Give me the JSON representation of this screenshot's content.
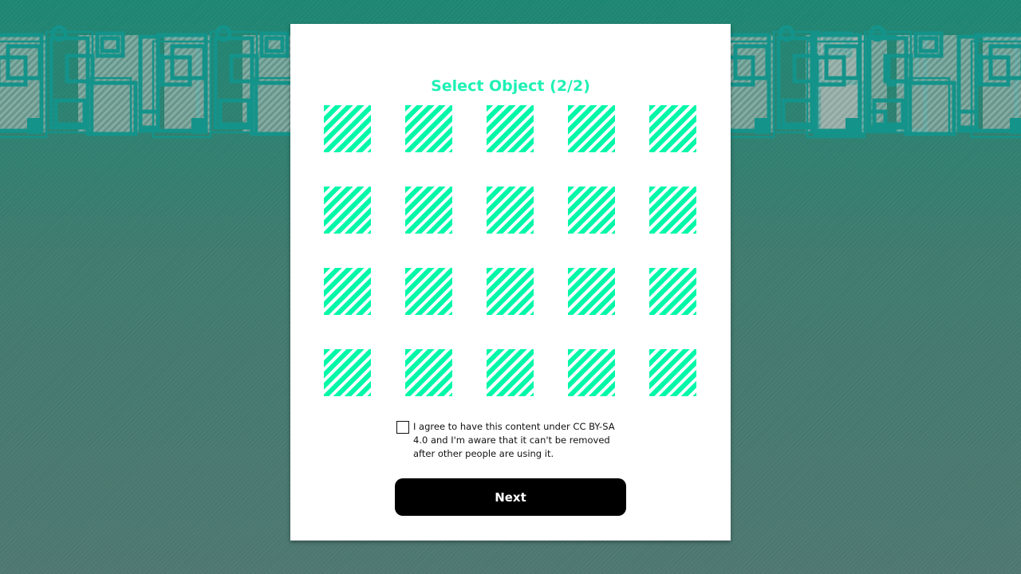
{
  "modal": {
    "title": "Select Object (2/2)",
    "tiles": [
      {
        "row": 1,
        "col": 1
      },
      {
        "row": 1,
        "col": 2
      },
      {
        "row": 1,
        "col": 3
      },
      {
        "row": 1,
        "col": 4
      },
      {
        "row": 1,
        "col": 5
      },
      {
        "row": 2,
        "col": 1
      },
      {
        "row": 2,
        "col": 2
      },
      {
        "row": 2,
        "col": 3
      },
      {
        "row": 2,
        "col": 4
      },
      {
        "row": 2,
        "col": 5
      },
      {
        "row": 3,
        "col": 1
      },
      {
        "row": 3,
        "col": 2
      },
      {
        "row": 3,
        "col": 3
      },
      {
        "row": 3,
        "col": 4
      },
      {
        "row": 3,
        "col": 5
      },
      {
        "row": 4,
        "col": 1
      },
      {
        "row": 4,
        "col": 2
      },
      {
        "row": 4,
        "col": 3
      },
      {
        "row": 4,
        "col": 4
      },
      {
        "row": 4,
        "col": 5
      }
    ],
    "consent": {
      "checked": false,
      "text": "I agree to have this content under CC BY-SA 4.0 and I'm aware that it can't be removed after other people are using it."
    },
    "next_label": "Next"
  },
  "colors": {
    "accent": "#00f7a8",
    "title": "#1ff0b4",
    "button_bg": "#000000",
    "button_text": "#ffffff",
    "background_top": "#1c8672",
    "background_bottom": "#4d7770",
    "pattern_stroke": "#1f8f85"
  }
}
